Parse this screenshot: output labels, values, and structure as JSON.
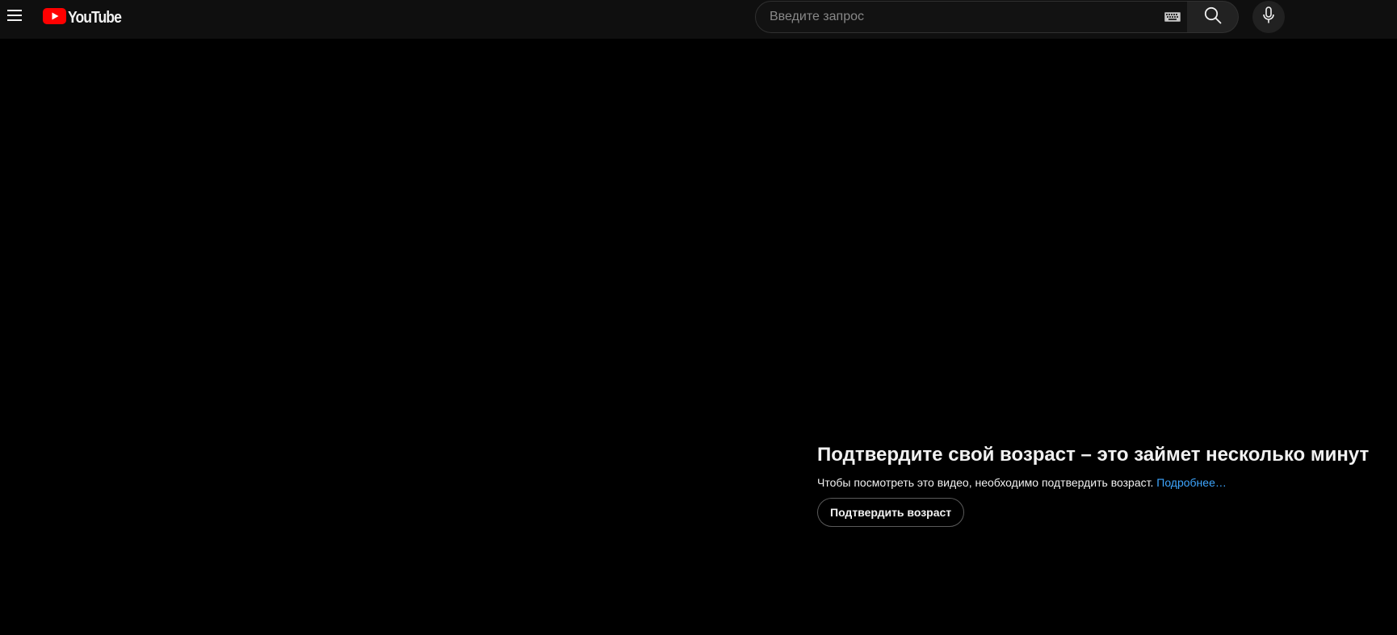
{
  "brand": {
    "logo_text": "YouTube",
    "logo_color": "#ff0000"
  },
  "header": {
    "menu_icon": "hamburger-menu-icon",
    "search": {
      "placeholder": "Введите запрос",
      "value": ""
    },
    "keyboard_icon": "keyboard-icon",
    "search_icon": "search-icon",
    "mic_icon": "microphone-icon"
  },
  "age_gate": {
    "title": "Подтвердите свой возраст – это займет несколько минут",
    "description": "Чтобы посмотреть это видео, необходимо подтвердить возраст.",
    "learn_more": "Подробнее…",
    "confirm_button": "Подтвердить возраст",
    "link_color": "#3ea6ff"
  }
}
